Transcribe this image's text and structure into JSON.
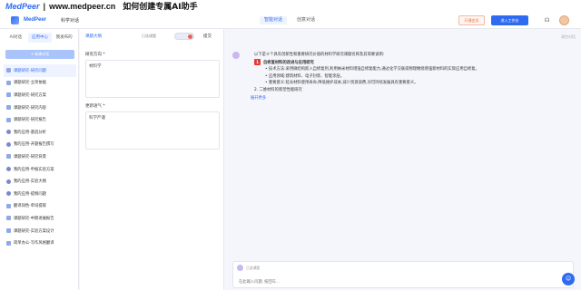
{
  "banner": {
    "logo": "MedPeer",
    "separator": "|",
    "url": "www.medpeer.cn",
    "slogan": "如何创建专属AI助手"
  },
  "header": {
    "brand": "MedPeer",
    "section": "科学对话",
    "tabs": [
      {
        "label": "智能对话",
        "active": true
      },
      {
        "label": "创意对话",
        "active": false
      }
    ],
    "member_label": "开通会员",
    "workspace_label": "进入工作台"
  },
  "sidebar": {
    "tabs": [
      {
        "label": "AI对话",
        "active": false
      },
      {
        "label": "应用中心",
        "active": true
      },
      {
        "label": "我发布的",
        "active": false
      }
    ],
    "new_button": "+ 新建对话",
    "items": [
      {
        "label": "课题研究-研究问题",
        "active": true
      },
      {
        "label": "课题研究-立项依据",
        "active": false
      },
      {
        "label": "课题研究-研究方案",
        "active": false
      },
      {
        "label": "课题研究-研究内容",
        "active": false
      },
      {
        "label": "课题研究-研究报告",
        "active": false
      },
      {
        "label": "我的应用-基因分析",
        "active": false
      },
      {
        "label": "我的应用-开题报告撰写",
        "active": false
      },
      {
        "label": "课题研究-研究背景",
        "active": false
      },
      {
        "label": "我的应用-申报实验方案",
        "active": false
      },
      {
        "label": "我的应用-实验大纲",
        "active": false
      },
      {
        "label": "我的应用-提纲问题",
        "active": false
      },
      {
        "label": "翻译润色-单词提取",
        "active": false
      },
      {
        "label": "课题研究-中期进展报告",
        "active": false
      },
      {
        "label": "课题研究-实验方案设计",
        "active": false
      },
      {
        "label": "简单办公-写作风格翻译",
        "active": false
      }
    ]
  },
  "form": {
    "title": "课题大纲",
    "badge": "已选课题",
    "submit": "提交",
    "field1_label": "研究方向 *",
    "field1_value": "材料学",
    "field2_label": "更新语气 *",
    "field2_value": "科学严谨"
  },
  "chat": {
    "clear": "清空对话",
    "intro": "以下是十个具有创新性和重要研究价值的材料学研究课题名称及其简要说明:",
    "item1_num": "1",
    "item1_title": "自修复材料的改进与应用研究",
    "item1_b1": "• 技术方法:采用微结构嵌入自修复剂,利用纳米材料增强自修复能力,通过化学交联或物理缠绕增强新材料的实际应用自修复。",
    "item1_b2": "• 应用领域:建筑材料、电子封装、智能涂层。",
    "item1_b3": "• 重要意义:延长材料使用寿命,降低维护成本,减少资源浪费,对可持续发展具有重要意义。",
    "item2_line": "2. 二维材料的新型性能研究",
    "more": "展开更多",
    "composer_title": "已选课题",
    "composer_placeholder": "在此输入问题, 按回车..."
  }
}
